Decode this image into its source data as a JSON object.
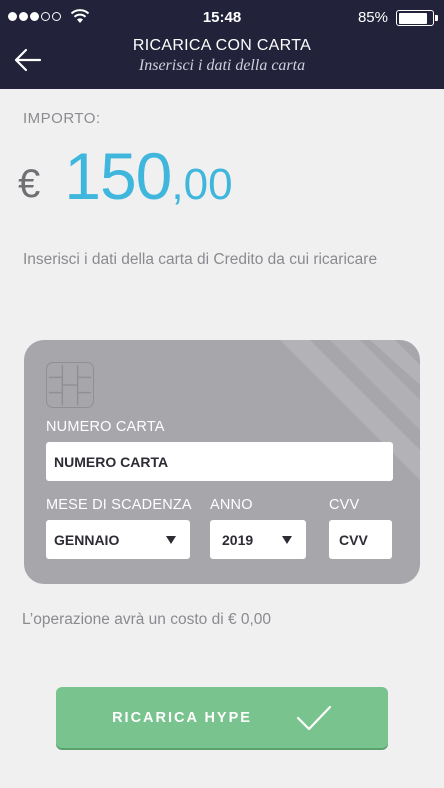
{
  "status_bar": {
    "time": "15:48",
    "battery_percent": "85%",
    "battery_level": 0.85,
    "signal_bars_filled": 3,
    "signal_bars_total": 5
  },
  "header": {
    "title": "RICARICA CON CARTA",
    "subtitle": "Inserisci i dati della carta",
    "background_color": "#22223a"
  },
  "amount": {
    "label": "IMPORTO:",
    "currency": "€",
    "integer": "150",
    "decimals": ",00",
    "color": "#3fb6dc"
  },
  "instructions": "Inserisci i dati della carta di Credito da cui ricaricare",
  "card": {
    "number_label": "NUMERO CARTA",
    "number_placeholder": "NUMERO CARTA",
    "expiry_month_label": "MESE DI SCADENZA",
    "expiry_month_value": "GENNAIO",
    "expiry_year_label": "ANNO",
    "expiry_year_value": "2019",
    "cvv_label": "CVV",
    "cvv_placeholder": "CVV"
  },
  "cost_note": "L’operazione avrà un costo di € 0,00",
  "cta": {
    "label": "RICARICA HYPE",
    "color": "#79c38e",
    "icon": "checkmark-icon"
  }
}
